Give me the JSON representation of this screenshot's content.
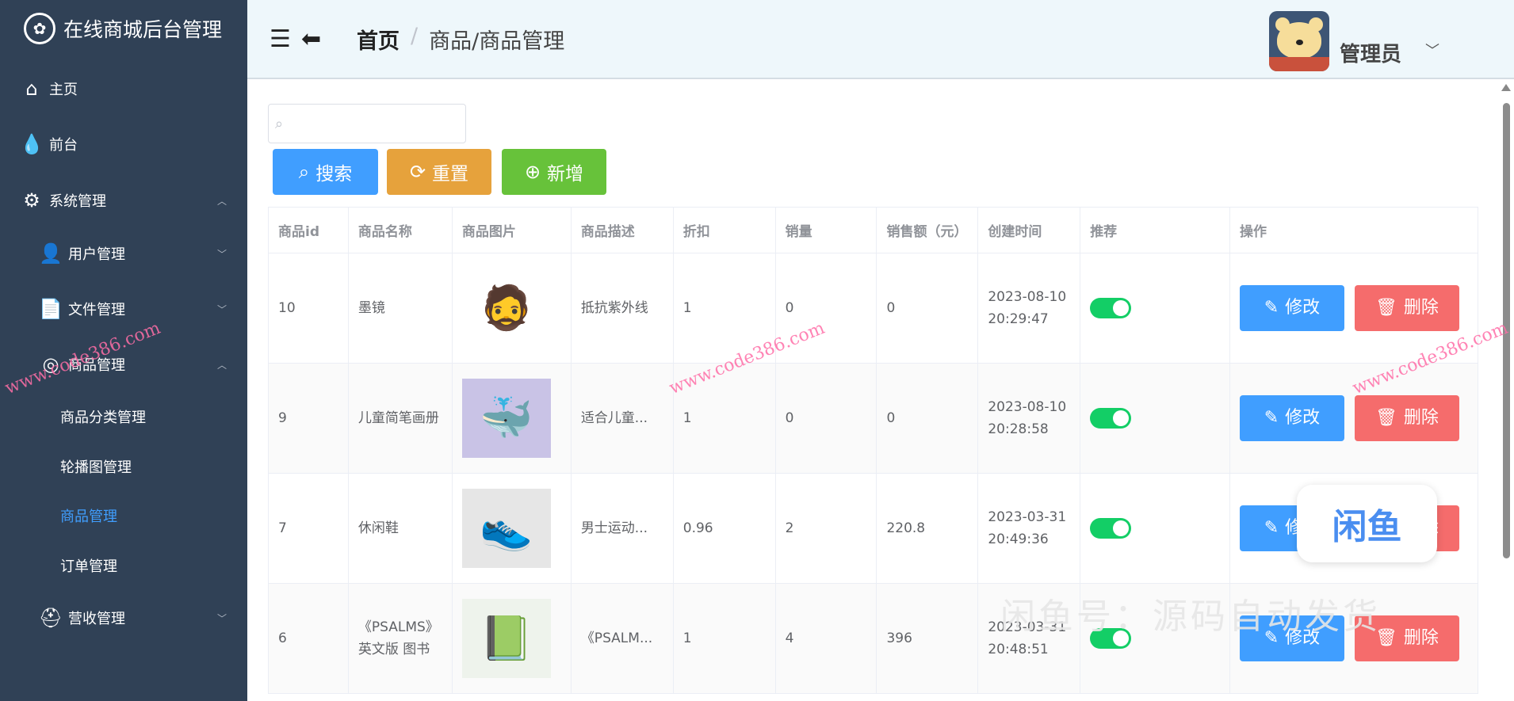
{
  "app_title": "在线商城后台管理",
  "sidebar": {
    "items": [
      {
        "label": "主页",
        "icon": "home-icon"
      },
      {
        "label": "前台",
        "icon": "drop-icon"
      },
      {
        "label": "系统管理",
        "icon": "gear-icon"
      },
      {
        "label": "用户管理",
        "icon": "user-icon"
      },
      {
        "label": "文件管理",
        "icon": "file-icon"
      },
      {
        "label": "商品管理",
        "icon": "product-icon"
      },
      {
        "label": "商品分类管理"
      },
      {
        "label": "轮播图管理"
      },
      {
        "label": "商品管理"
      },
      {
        "label": "订单管理"
      },
      {
        "label": "营收管理",
        "icon": "revenue-icon"
      }
    ]
  },
  "header": {
    "breadcrumb_home": "首页",
    "breadcrumb_sep": "/",
    "breadcrumb_current": "商品/商品管理",
    "username": "管理员"
  },
  "toolbar": {
    "search_value": "",
    "search_label": "搜索",
    "reset_label": "重置",
    "add_label": "新增"
  },
  "colors": {
    "primary": "#409eff",
    "warning": "#e6a23c",
    "success": "#67c23a",
    "danger": "#f56c6c",
    "sidebar": "#304156"
  },
  "table": {
    "headers": [
      "商品id",
      "商品名称",
      "商品图片",
      "商品描述",
      "折扣",
      "销量",
      "销售额（元）",
      "创建时间",
      "推荐",
      "操作"
    ],
    "edit_label": "修改",
    "delete_label": "删除",
    "rows": [
      {
        "id": "10",
        "name": "墨镜",
        "desc": "抵抗紫外线",
        "discount": "1",
        "sales": "0",
        "revenue": "0",
        "created": "2023-08-10 20:29:47",
        "recommended": true
      },
      {
        "id": "9",
        "name": "儿童简笔画册",
        "desc": "适合儿童...",
        "discount": "1",
        "sales": "0",
        "revenue": "0",
        "created": "2023-08-10 20:28:58",
        "recommended": true
      },
      {
        "id": "7",
        "name": "休闲鞋",
        "desc": "男士运动...",
        "discount": "0.96",
        "sales": "2",
        "revenue": "220.8",
        "created": "2023-03-31 20:49:36",
        "recommended": true
      },
      {
        "id": "6",
        "name": "《PSALMS》英文版 图书",
        "desc": "《PSALM...",
        "discount": "1",
        "sales": "4",
        "revenue": "396",
        "created": "2023-03-31 20:48:51",
        "recommended": true
      }
    ]
  },
  "watermarks": {
    "site": "www.code386.com",
    "xianyu": "闲鱼号：源码自动发货",
    "badge": "闲鱼"
  }
}
